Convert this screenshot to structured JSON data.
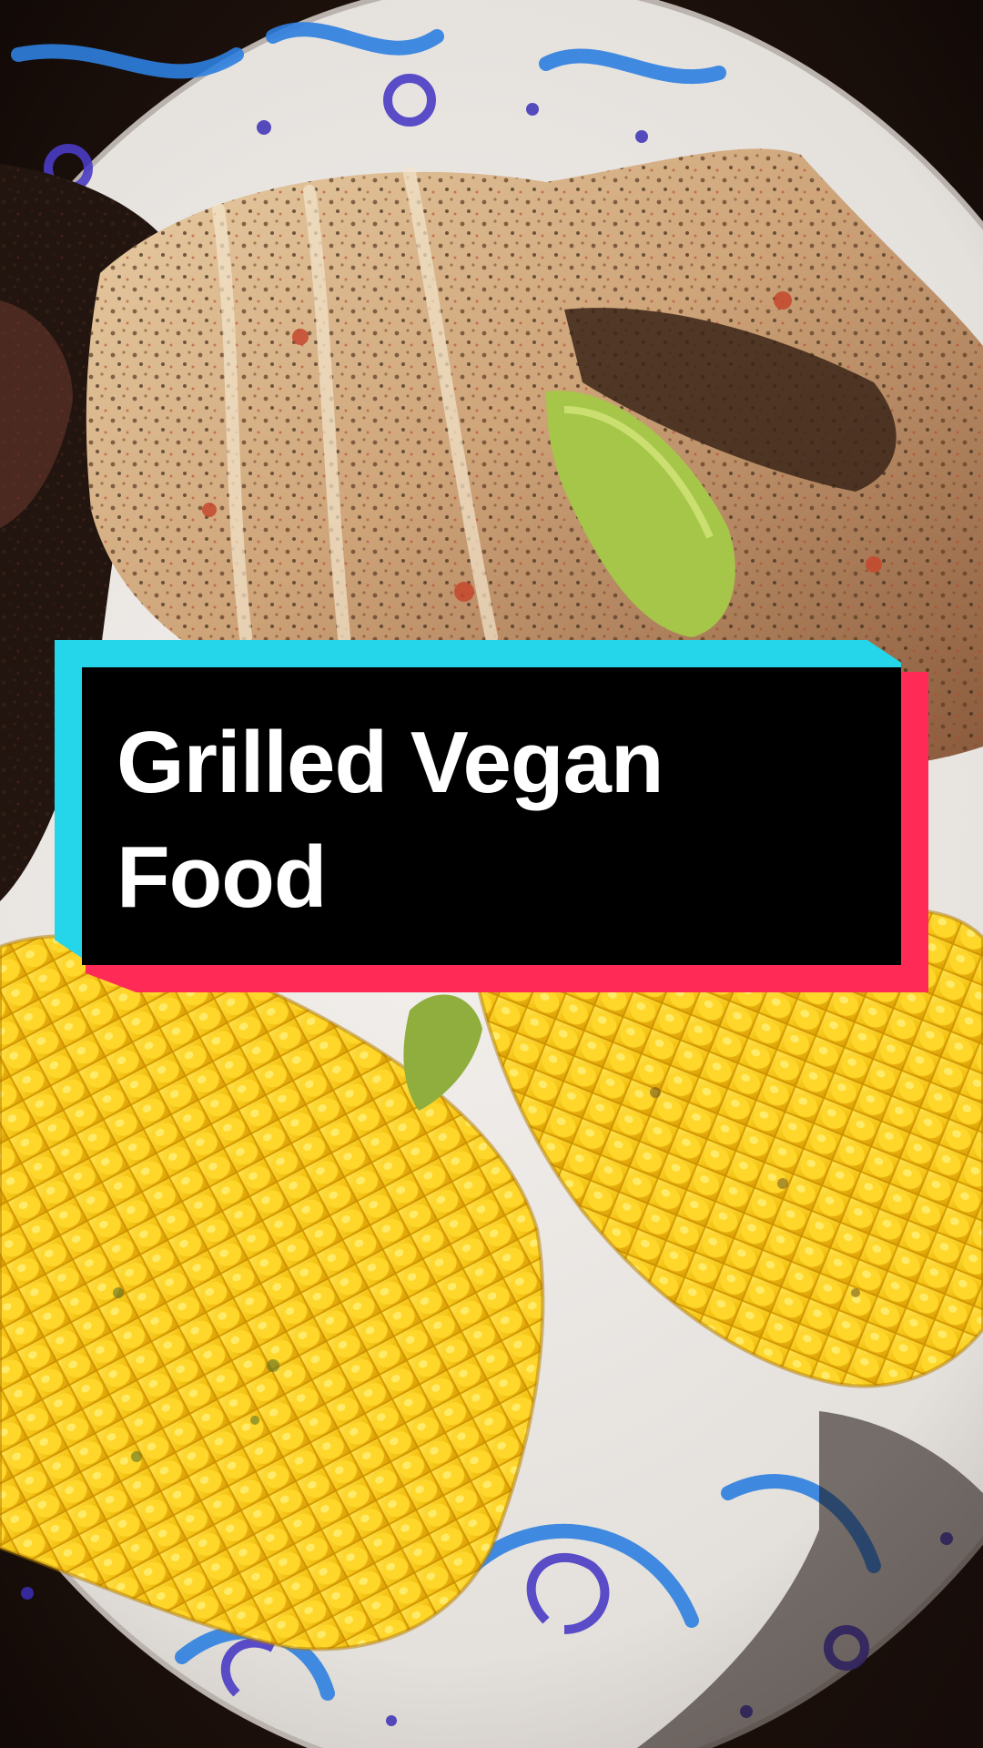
{
  "overlay": {
    "title_lines": [
      "Grilled Vegan",
      "Food"
    ]
  },
  "palette": {
    "accent_cyan": "#25d5ea",
    "accent_red": "#ff2a56",
    "card_fill": "#000000",
    "text": "#ffffff"
  },
  "photo": {
    "icons": [
      "paper-plate",
      "grilled-vegetable-casserole",
      "corn-cob",
      "corn-cob",
      "dark-grilled-vegetable"
    ]
  }
}
